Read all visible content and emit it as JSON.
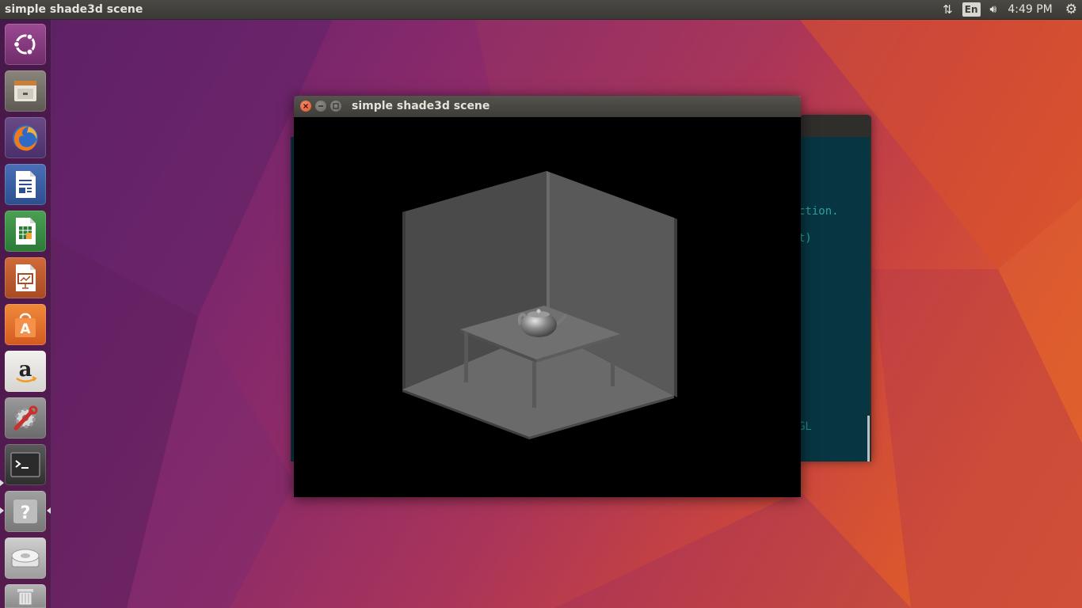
{
  "top_panel": {
    "app_title": "simple shade3d scene",
    "language": "En",
    "clock": "4:49 PM"
  },
  "launcher": {
    "items": [
      {
        "name": "ubuntu-dash",
        "color": "#8a3a84"
      },
      {
        "name": "files",
        "color": "#7c776e"
      },
      {
        "name": "firefox",
        "color": "#2a5fa8"
      },
      {
        "name": "libreoffice-writer",
        "color": "#2e5ca7"
      },
      {
        "name": "libreoffice-calc",
        "color": "#2f8b3a"
      },
      {
        "name": "libreoffice-impress",
        "color": "#b9552b"
      },
      {
        "name": "ubuntu-software",
        "color": "#e06a2e"
      },
      {
        "name": "amazon",
        "color": "#e8e6e2"
      },
      {
        "name": "system-settings",
        "color": "#7c7c7c"
      },
      {
        "name": "terminal",
        "color": "#3a3a3a"
      },
      {
        "name": "help",
        "color": "#8a8a8a"
      },
      {
        "name": "disk",
        "color": "#b8b8b8"
      },
      {
        "name": "trash",
        "color": "#9a9a9a"
      }
    ]
  },
  "app_window": {
    "title": "simple shade3d scene"
  },
  "terminal": {
    "lines": [
      {
        "text": "ction.",
        "row": 0
      },
      {
        "text": "t)",
        "row": 1
      },
      {
        "text": "GL",
        "row": 2
      }
    ]
  }
}
